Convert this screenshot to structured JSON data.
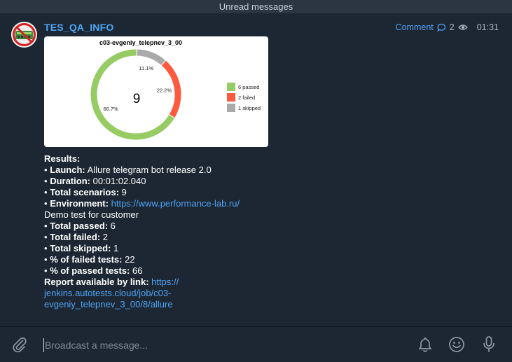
{
  "header": {
    "unread_label": "Unread messages"
  },
  "post": {
    "channel_name": "TES_QA_INFO",
    "comment_label": "Comment",
    "comment_count": "2",
    "time": "01:31"
  },
  "chart_data": {
    "type": "pie",
    "title": "c03-evgeniy_telepnev_3_00",
    "center_label": "9",
    "slices": [
      {
        "label": "6 passed",
        "value": 6,
        "percent_label": "66.7%",
        "color": "#97cc64"
      },
      {
        "label": "2 failed",
        "value": 2,
        "percent_label": "22.2%",
        "color": "#fd5a3e"
      },
      {
        "label": "1 skipped",
        "value": 1,
        "percent_label": "11.1%",
        "color": "#aaaaaa"
      }
    ],
    "legend_position": "right"
  },
  "message": {
    "results_heading": "Results:",
    "bullet": "•",
    "launch_label": "Launch:",
    "launch_value": "Allure telegram bot release 2.0",
    "duration_label": "Duration:",
    "duration_value": "00:01:02.040",
    "scenarios_label": "Total scenarios:",
    "scenarios_value": "9",
    "environment_label": "Environment:",
    "environment_value": "https://www.performance-lab.ru/",
    "description": "Demo test for customer",
    "passed_label": "Total passed:",
    "passed_value": "6",
    "failed_label": "Total failed:",
    "failed_value": "2",
    "skipped_label": "Total skipped:",
    "skipped_value": "1",
    "pct_failed_label": "% of failed tests:",
    "pct_failed_value": "22",
    "pct_passed_label": "% of passed tests:",
    "pct_passed_value": "66",
    "report_label": "Report available by link:",
    "report_link_1": "https://",
    "report_link_2": "jenkins.autotests.cloud/job/c03-",
    "report_link_3": "evgeniy_telepnev_3_00/8/allure"
  },
  "composer": {
    "placeholder": "Broadcast a message...",
    "icons": [
      "paperclip-icon",
      "bell-icon",
      "emoji-icon",
      "microphone-icon"
    ]
  }
}
